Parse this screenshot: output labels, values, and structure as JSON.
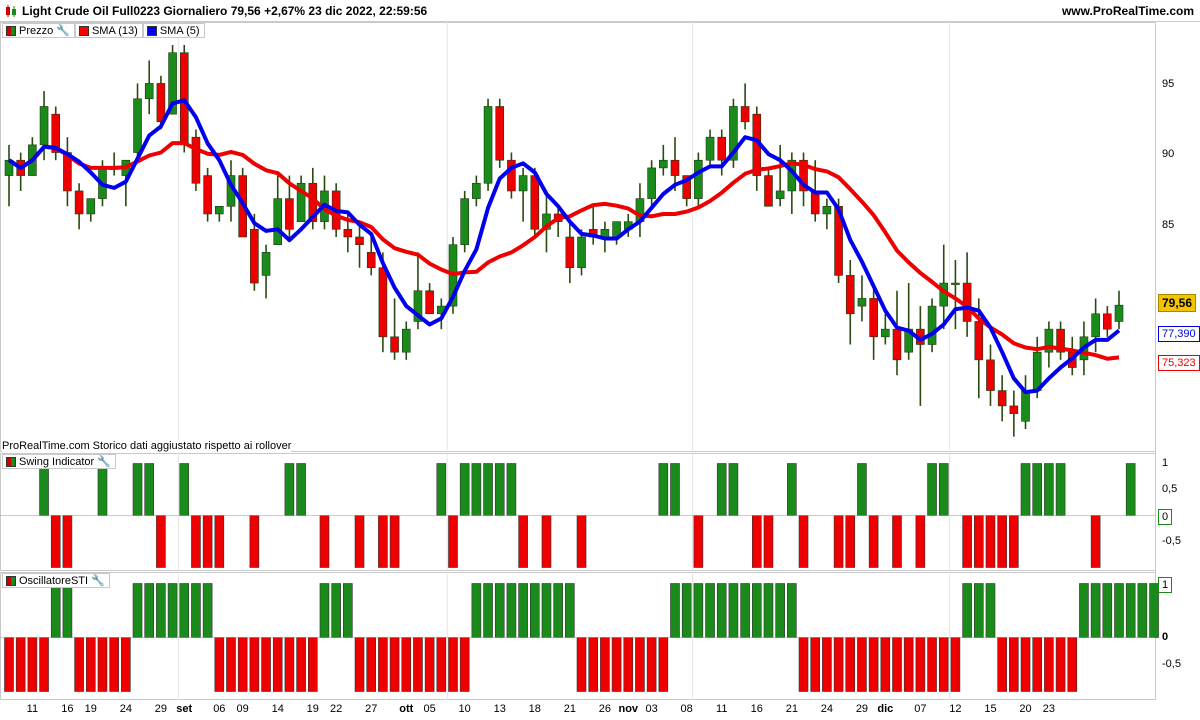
{
  "header": {
    "title": "Light Crude Oil Full0223 Giornaliero 79,56 +2,67% 23 dic 2022, 22:59:56",
    "site": "www.ProRealTime.com"
  },
  "price_panel": {
    "legend": [
      {
        "label": "Prezzo",
        "icon": "candle-icon"
      },
      {
        "label": "SMA (13)",
        "color": "#ff0000"
      },
      {
        "label": "SMA (5)",
        "color": "#0000ee"
      }
    ],
    "note": "ProRealTime.com Storico dati aggiustato rispetto ai rollover",
    "y_ticks": [
      "95",
      "90",
      "85",
      "79,56",
      "77,390",
      "75,323"
    ],
    "y_ticks_plain": [
      "95",
      "90",
      "85"
    ],
    "last_price": "79,56",
    "sma5_value": "77,390",
    "sma13_value": "75,323"
  },
  "swing_panel": {
    "legend": "Swing Indicator",
    "y_ticks": [
      "1",
      "0,5",
      "0",
      "-0,5"
    ]
  },
  "osc_panel": {
    "legend": "OscillatoreSTI",
    "y_ticks": [
      "1",
      "0",
      "-0,5"
    ]
  },
  "x_axis": {
    "labels": [
      "11",
      "16",
      "19",
      "24",
      "29",
      "set",
      "06",
      "09",
      "14",
      "19",
      "22",
      "27",
      "ott",
      "05",
      "10",
      "13",
      "18",
      "21",
      "26",
      "nov",
      "03",
      "08",
      "11",
      "16",
      "21",
      "24",
      "29",
      "dic",
      "07",
      "12",
      "15",
      "20",
      "23"
    ],
    "months": [
      "set",
      "ott",
      "nov",
      "dic"
    ]
  },
  "colors": {
    "up": "#1a8a1a",
    "down": "#ee0000",
    "sma13": "#ee0000",
    "sma5": "#0000ee"
  },
  "chart_data": [
    {
      "type": "candlestick",
      "title": "Light Crude Oil Full0223 Giornaliero",
      "ylim": [
        70,
        98
      ],
      "series": [
        {
          "name": "Prezzo",
          "ohlc": [
            [
              88,
              90,
              86,
              89
            ],
            [
              89,
              89.5,
              87,
              88
            ],
            [
              88,
              90.5,
              88,
              90
            ],
            [
              90,
              93.5,
              89,
              92.5
            ],
            [
              92,
              92.5,
              89,
              89.5
            ],
            [
              89.5,
              90.5,
              86,
              87
            ],
            [
              87,
              87.5,
              84.5,
              85.5
            ],
            [
              85.5,
              86.5,
              85,
              86.5
            ],
            [
              86.5,
              89,
              86,
              88.5
            ],
            [
              88.5,
              89.5,
              88,
              88.5
            ],
            [
              88,
              89,
              86,
              89
            ],
            [
              89.5,
              94,
              89,
              93
            ],
            [
              93,
              95.5,
              92,
              94
            ],
            [
              94,
              94.5,
              91,
              91.5
            ],
            [
              92,
              96.5,
              92,
              96
            ],
            [
              96,
              96.5,
              89.5,
              90
            ],
            [
              90.5,
              91,
              87,
              87.5
            ],
            [
              88,
              88.5,
              85,
              85.5
            ],
            [
              85.5,
              86,
              85,
              86
            ],
            [
              86,
              89,
              85,
              88
            ],
            [
              88,
              88.5,
              84,
              84
            ],
            [
              84.5,
              85.5,
              80.5,
              81
            ],
            [
              81.5,
              83.5,
              80,
              83
            ],
            [
              83.5,
              88,
              83.5,
              86.5
            ],
            [
              86.5,
              88,
              84,
              84.5
            ],
            [
              85,
              88,
              85,
              87.5
            ],
            [
              87.5,
              88.5,
              84.5,
              85
            ],
            [
              85,
              88,
              84.5,
              87
            ],
            [
              87,
              87.5,
              84,
              84.5
            ],
            [
              84.5,
              85.5,
              83,
              84
            ],
            [
              84,
              85,
              82,
              83.5
            ],
            [
              83,
              84,
              81.5,
              82
            ],
            [
              82,
              83,
              76.5,
              77.5
            ],
            [
              77.5,
              80,
              76,
              76.5
            ],
            [
              76.5,
              78.5,
              76,
              78
            ],
            [
              78.5,
              83,
              78,
              80.5
            ],
            [
              80.5,
              81,
              79,
              79
            ],
            [
              79,
              80,
              78,
              79.5
            ],
            [
              79.5,
              84,
              79,
              83.5
            ],
            [
              83.5,
              87,
              83,
              86.5
            ],
            [
              86.5,
              88,
              86,
              87.5
            ],
            [
              87.5,
              93,
              87,
              92.5
            ],
            [
              92.5,
              93,
              88.5,
              89
            ],
            [
              89,
              89.5,
              86.5,
              87
            ],
            [
              87,
              88.5,
              85,
              88
            ],
            [
              88,
              88.5,
              84,
              84.5
            ],
            [
              84.5,
              87,
              83,
              85.5
            ],
            [
              85.5,
              86,
              84,
              85
            ],
            [
              84,
              85,
              81,
              82
            ],
            [
              82,
              84.5,
              81.5,
              84
            ],
            [
              84.5,
              86,
              83.5,
              84
            ],
            [
              84,
              85,
              83,
              84.5
            ],
            [
              84,
              85,
              83.5,
              85
            ],
            [
              84.5,
              85.5,
              84,
              85
            ],
            [
              85,
              87.5,
              84,
              86.5
            ],
            [
              86.5,
              89,
              86,
              88.5
            ],
            [
              88.5,
              90,
              88,
              89
            ],
            [
              89,
              90.5,
              87,
              88
            ],
            [
              88,
              88,
              86,
              86.5
            ],
            [
              86.5,
              89.5,
              86,
              89
            ],
            [
              89,
              91,
              88.5,
              90.5
            ],
            [
              90.5,
              91,
              88,
              89
            ],
            [
              89,
              93,
              88.5,
              92.5
            ],
            [
              92.5,
              94,
              91,
              91.5
            ],
            [
              92,
              92.5,
              87,
              88
            ],
            [
              88,
              88.5,
              86,
              86
            ],
            [
              86.5,
              90,
              86,
              87
            ],
            [
              87,
              89.5,
              85.5,
              89
            ],
            [
              89,
              89.5,
              86,
              87
            ],
            [
              87,
              89,
              85,
              85.5
            ],
            [
              85.5,
              86.5,
              84.5,
              86
            ],
            [
              86,
              86.5,
              81,
              81.5
            ],
            [
              81.5,
              82.5,
              77,
              79
            ],
            [
              79.5,
              81.5,
              78.5,
              80
            ],
            [
              80,
              81,
              76,
              77.5
            ],
            [
              77.5,
              79,
              77,
              78
            ],
            [
              78,
              80.5,
              75,
              76
            ],
            [
              76.5,
              81,
              76,
              78
            ],
            [
              78,
              79.5,
              73,
              77
            ],
            [
              77,
              80,
              76.5,
              79.5
            ],
            [
              79.5,
              83.5,
              78,
              81
            ],
            [
              81,
              82.5,
              78,
              81
            ],
            [
              81,
              83,
              77.5,
              78.5
            ],
            [
              78.5,
              80,
              73.5,
              76
            ],
            [
              76,
              77,
              73,
              74
            ],
            [
              74,
              75,
              72,
              73
            ],
            [
              73,
              74,
              71,
              72.5
            ],
            [
              72,
              75,
              71.5,
              74
            ],
            [
              74,
              77.5,
              73.5,
              76.5
            ],
            [
              76.5,
              78.5,
              75.5,
              78
            ],
            [
              78,
              78.5,
              76,
              76.5
            ],
            [
              76.5,
              77.5,
              75,
              75.5
            ],
            [
              76,
              78.5,
              75,
              77.5
            ],
            [
              77.5,
              80,
              76.5,
              79
            ],
            [
              79,
              79.5,
              77.5,
              78
            ],
            [
              78.5,
              80.5,
              78,
              79.56
            ]
          ]
        },
        {
          "name": "SMA (13)"
        },
        {
          "name": "SMA (5)"
        }
      ]
    },
    {
      "type": "bar",
      "title": "Swing Indicator",
      "ylim": [
        -1,
        1
      ],
      "values": [
        0,
        0,
        0,
        1,
        -1,
        -1,
        0,
        0,
        1,
        0,
        0,
        1,
        1,
        -1,
        0,
        1,
        -1,
        -1,
        -1,
        0,
        0,
        -1,
        0,
        0,
        1,
        1,
        0,
        -1,
        0,
        0,
        -1,
        0,
        -1,
        -1,
        0,
        0,
        0,
        1,
        -1,
        1,
        1,
        1,
        1,
        1,
        -1,
        0,
        -1,
        0,
        0,
        -1,
        0,
        0,
        0,
        0,
        0,
        0,
        1,
        1,
        0,
        -1,
        0,
        1,
        1,
        0,
        -1,
        -1,
        0,
        1,
        -1,
        0,
        0,
        -1,
        -1,
        1,
        -1,
        0,
        -1,
        0,
        -1,
        1,
        1,
        0,
        -1,
        -1,
        -1,
        -1,
        -1,
        1,
        1,
        1,
        1,
        0,
        0,
        -1,
        0,
        0,
        1,
        0,
        0
      ]
    },
    {
      "type": "bar",
      "title": "OscillatoreSTI",
      "ylim": [
        -1,
        1
      ],
      "values": [
        -1,
        -1,
        -1,
        -1,
        1,
        1,
        -1,
        -1,
        -1,
        -1,
        -1,
        1,
        1,
        1,
        1,
        1,
        1,
        1,
        -1,
        -1,
        -1,
        -1,
        -1,
        -1,
        -1,
        -1,
        -1,
        1,
        1,
        1,
        -1,
        -1,
        -1,
        -1,
        -1,
        -1,
        -1,
        -1,
        -1,
        -1,
        1,
        1,
        1,
        1,
        1,
        1,
        1,
        1,
        1,
        -1,
        -1,
        -1,
        -1,
        -1,
        -1,
        -1,
        -1,
        1,
        1,
        1,
        1,
        1,
        1,
        1,
        1,
        1,
        1,
        1,
        -1,
        -1,
        -1,
        -1,
        -1,
        -1,
        -1,
        -1,
        -1,
        -1,
        -1,
        -1,
        -1,
        -1,
        1,
        1,
        1,
        -1,
        -1,
        -1,
        -1,
        -1,
        -1,
        -1,
        1,
        1,
        1,
        1,
        1,
        1,
        1
      ]
    }
  ]
}
